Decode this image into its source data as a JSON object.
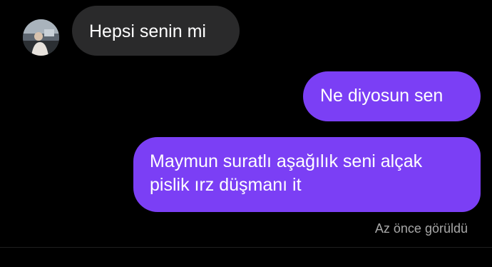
{
  "conversation": {
    "incoming": [
      {
        "text": "Hepsi senin mi"
      }
    ],
    "outgoing": [
      {
        "lines": [
          "Ne diyosun sen"
        ]
      },
      {
        "lines": [
          "Maymun suratlı aşağılık seni alçak",
          "pislik ırz düşmanı it"
        ]
      }
    ],
    "seen_status": "Az önce görüldü"
  },
  "avatar": {
    "icon": "contact-avatar-photo"
  },
  "colors": {
    "background": "#000000",
    "incoming_bubble": "#2a2a2b",
    "outgoing_bubble": "#7b3ff5",
    "text": "#ffffff",
    "status_text": "#a8a8a8"
  }
}
